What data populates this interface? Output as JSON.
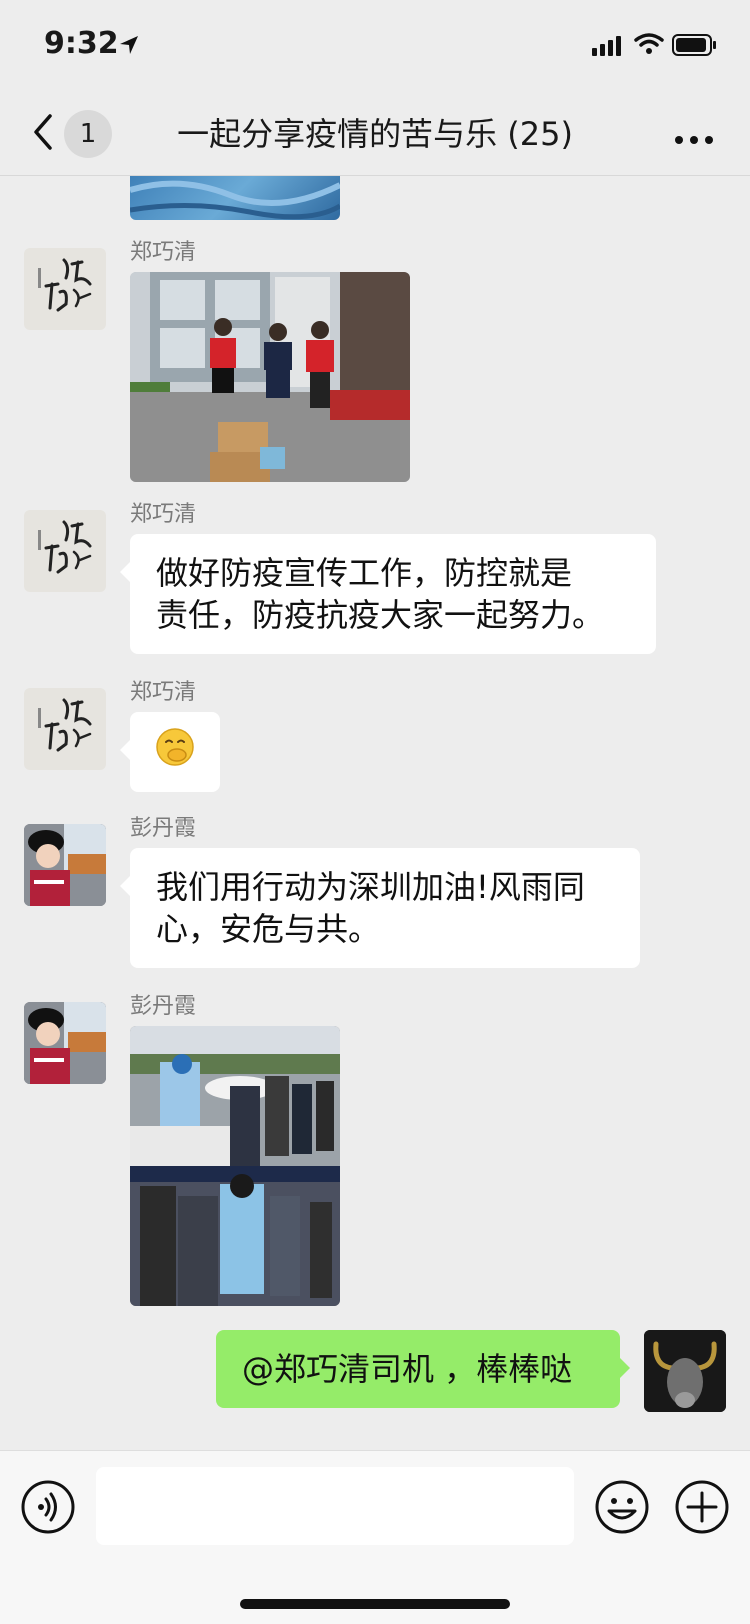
{
  "status_bar": {
    "time": "9:32"
  },
  "nav": {
    "unread_count": "1",
    "title": "一起分享疫情的苦与乐 (25)"
  },
  "messages": [
    {
      "type": "image",
      "sender": "",
      "description": "blue packaging partially visible"
    },
    {
      "type": "image",
      "sender": "郑巧清"
    },
    {
      "type": "text",
      "sender": "郑巧清",
      "text_line1": "做好防疫宣传工作，防控就是",
      "text_line2": "责任，防疫抗疫大家一起努力。"
    },
    {
      "type": "emoji",
      "sender": "郑巧清",
      "emoji": "🤭"
    },
    {
      "type": "text",
      "sender": "彭丹霞",
      "text_line1": "我们用行动为深圳加油!风雨同",
      "text_line2": "心，安危与共。"
    },
    {
      "type": "image",
      "sender": "彭丹霞"
    },
    {
      "type": "text",
      "sender": "me",
      "text": "@郑巧清司机 ，棒棒哒"
    }
  ],
  "input": {
    "placeholder": ""
  },
  "colors": {
    "background": "#ededed",
    "self_bubble": "#95ec69",
    "other_bubble": "#ffffff"
  },
  "icons": [
    "location-arrow-icon",
    "signal-icon",
    "wifi-icon",
    "battery-icon",
    "back-icon",
    "more-icon",
    "voice-icon",
    "emoji-icon",
    "plus-icon"
  ]
}
